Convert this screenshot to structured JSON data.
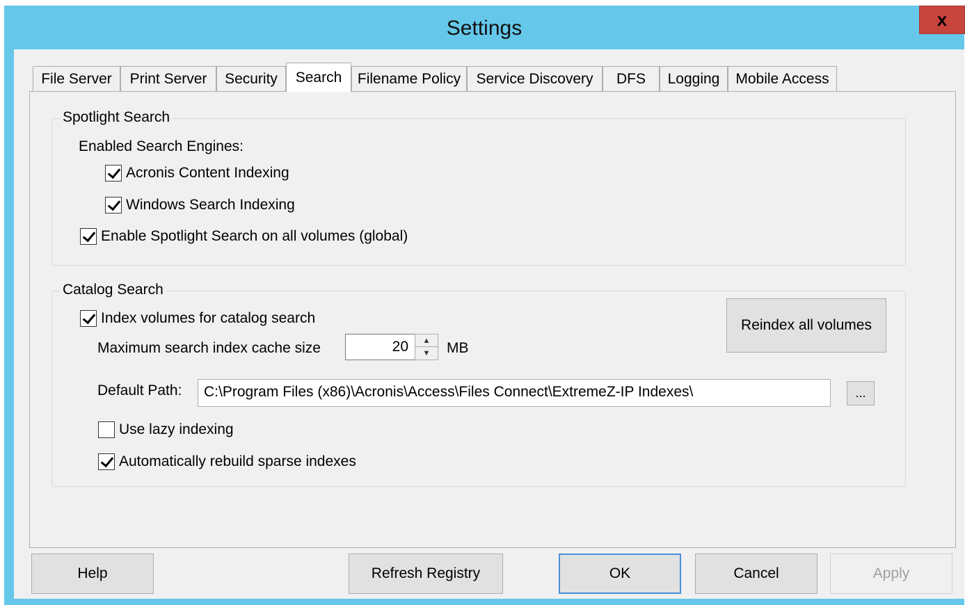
{
  "window": {
    "title": "Settings",
    "close_glyph": "x"
  },
  "tabs": [
    {
      "label": "File Server"
    },
    {
      "label": "Print Server"
    },
    {
      "label": "Security"
    },
    {
      "label": "Search",
      "active": true
    },
    {
      "label": "Filename Policy"
    },
    {
      "label": "Service Discovery"
    },
    {
      "label": "DFS"
    },
    {
      "label": "Logging"
    },
    {
      "label": "Mobile Access"
    }
  ],
  "spotlight": {
    "legend": "Spotlight Search",
    "engines_label": "Enabled Search Engines:",
    "acronis_indexing": {
      "label": "Acronis Content Indexing",
      "checked": true
    },
    "windows_indexing": {
      "label": "Windows Search Indexing",
      "checked": true
    },
    "enable_global": {
      "label": "Enable Spotlight Search on all volumes (global)",
      "checked": true
    }
  },
  "catalog": {
    "legend": "Catalog Search",
    "index_volumes": {
      "label": "Index volumes for catalog search",
      "checked": true
    },
    "cache_label": "Maximum search index cache size",
    "cache_value": "20",
    "cache_unit": "MB",
    "reindex_button": "Reindex all volumes",
    "default_path_label": "Default Path:",
    "default_path_value": "C:\\Program Files (x86)\\Acronis\\Access\\Files Connect\\ExtremeZ-IP Indexes\\",
    "browse_button": "...",
    "lazy_indexing": {
      "label": "Use lazy indexing",
      "checked": false
    },
    "rebuild_sparse": {
      "label": "Automatically rebuild sparse indexes",
      "checked": true
    }
  },
  "footer": {
    "help": "Help",
    "refresh_registry": "Refresh Registry",
    "ok": "OK",
    "cancel": "Cancel",
    "apply": "Apply"
  }
}
